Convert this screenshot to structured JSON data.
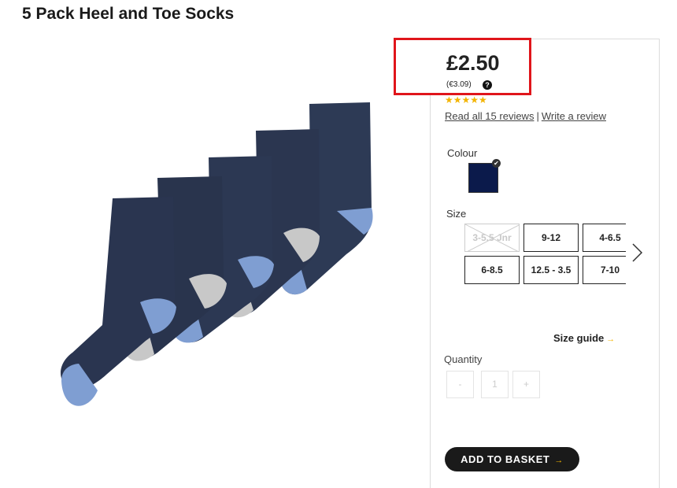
{
  "product": {
    "title": "5 Pack Heel and Toe Socks",
    "image_alt": "socks-image"
  },
  "price": {
    "main": "£2.50",
    "euro": "(€3.09)",
    "help_icon": "question-icon"
  },
  "rating": {
    "stars": "★★★★★",
    "value_of_5": 5,
    "read_reviews": "Read all 15 reviews",
    "separator": "|",
    "write_review": "Write a review"
  },
  "colour": {
    "label": "Colour",
    "selected_hex": "#0b1a4b"
  },
  "size": {
    "label": "Size",
    "options": [
      {
        "label": "3-5.5 Jnr",
        "available": false
      },
      {
        "label": "9-12",
        "available": true
      },
      {
        "label": "4-6.5",
        "available": true
      },
      {
        "label": "6-8.5",
        "available": true
      },
      {
        "label": "12.5 - 3.5",
        "available": true
      },
      {
        "label": "7-10",
        "available": true
      }
    ],
    "next_icon": "chevron-right-icon",
    "guide": "Size guide",
    "guide_arrow": "→"
  },
  "quantity": {
    "label": "Quantity",
    "minus": "-",
    "value": "1",
    "plus": "+"
  },
  "basket": {
    "label": "ADD TO BASKET",
    "arrow": "→"
  },
  "colors": {
    "highlight": "#e0151b",
    "star": "#f3b400",
    "button": "#1a1a1a"
  }
}
